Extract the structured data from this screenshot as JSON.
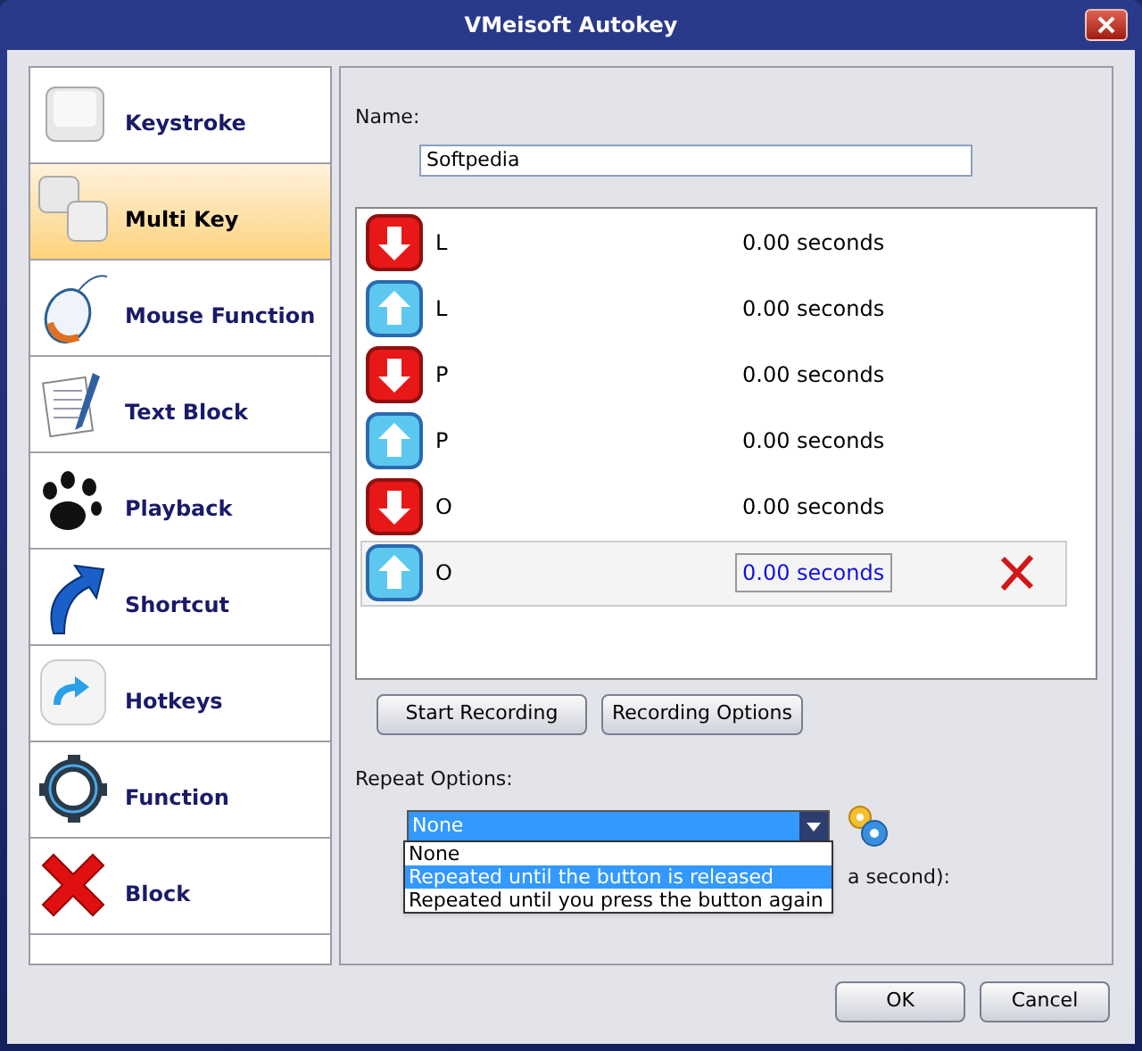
{
  "window": {
    "title": "VMeisoft Autokey"
  },
  "sidebar": {
    "items": [
      {
        "label": "Keystroke",
        "kind": "keystroke",
        "selected": false
      },
      {
        "label": "Multi Key",
        "kind": "multikey",
        "selected": true
      },
      {
        "label": "Mouse Function",
        "kind": "mouse",
        "selected": false
      },
      {
        "label": "Text Block",
        "kind": "text",
        "selected": false
      },
      {
        "label": "Playback",
        "kind": "playback",
        "selected": false
      },
      {
        "label": "Shortcut",
        "kind": "shortcut",
        "selected": false
      },
      {
        "label": "Hotkeys",
        "kind": "hotkeys",
        "selected": false
      },
      {
        "label": "Function",
        "kind": "function",
        "selected": false
      },
      {
        "label": "Block",
        "kind": "block",
        "selected": false
      }
    ]
  },
  "name_field": {
    "label": "Name:",
    "value": "Softpedia"
  },
  "events": [
    {
      "kind": "down",
      "key": "L",
      "delay": "0.00 seconds",
      "selected": false
    },
    {
      "kind": "up",
      "key": "L",
      "delay": "0.00 seconds",
      "selected": false
    },
    {
      "kind": "down",
      "key": "P",
      "delay": "0.00 seconds",
      "selected": false
    },
    {
      "kind": "up",
      "key": "P",
      "delay": "0.00 seconds",
      "selected": false
    },
    {
      "kind": "down",
      "key": "O",
      "delay": "0.00 seconds",
      "selected": false
    },
    {
      "kind": "up",
      "key": "O",
      "delay": "0.00 seconds",
      "selected": true
    }
  ],
  "buttons": [
    "Start Recording",
    "Recording Options"
  ],
  "repeat": {
    "label": "Repeat Options:",
    "value": "None",
    "options": [
      {
        "label": "None",
        "highlighted": false
      },
      {
        "label": "Repeated until the button is released",
        "highlighted": true
      },
      {
        "label": "Repeated until you press the button again",
        "highlighted": false
      }
    ],
    "hidden_label": "a second):"
  },
  "footer_buttons": [
    "OK",
    "Cancel"
  ]
}
